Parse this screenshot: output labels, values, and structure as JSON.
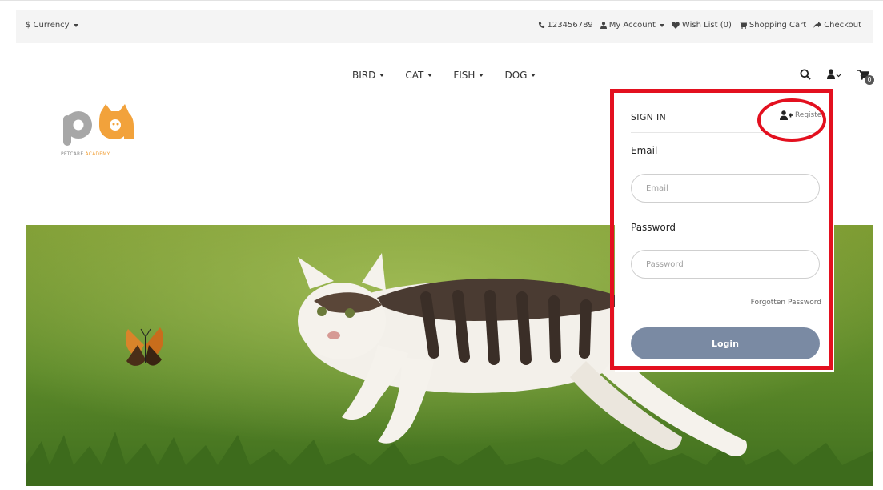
{
  "colors": {
    "accent_red": "#e3101f",
    "button": "#7a8aa3",
    "logo_orange": "#f2a23b",
    "logo_grey": "#a7a7a7"
  },
  "topbar": {
    "currency_label": "$ Currency",
    "phone": "123456789",
    "my_account": "My Account",
    "wish_list": "Wish List (0)",
    "shopping_cart": "Shopping Cart",
    "checkout": "Checkout"
  },
  "logo": {
    "text_primary": "PETCARE",
    "text_accent": "ACADEMY"
  },
  "nav": {
    "items": [
      {
        "label": "BIRD"
      },
      {
        "label": "CAT"
      },
      {
        "label": "FISH"
      },
      {
        "label": "DOG"
      }
    ]
  },
  "header_icons": {
    "search": "search-icon",
    "user": "user-icon",
    "cart": "cart-icon",
    "cart_count": "0"
  },
  "signin": {
    "title": "SIGN IN",
    "register": "Register",
    "email_label": "Email",
    "email_placeholder": "Email",
    "email_value": "",
    "password_label": "Password",
    "password_placeholder": "Password",
    "password_value": "",
    "forgot": "Forgotten Password",
    "login": "Login"
  }
}
